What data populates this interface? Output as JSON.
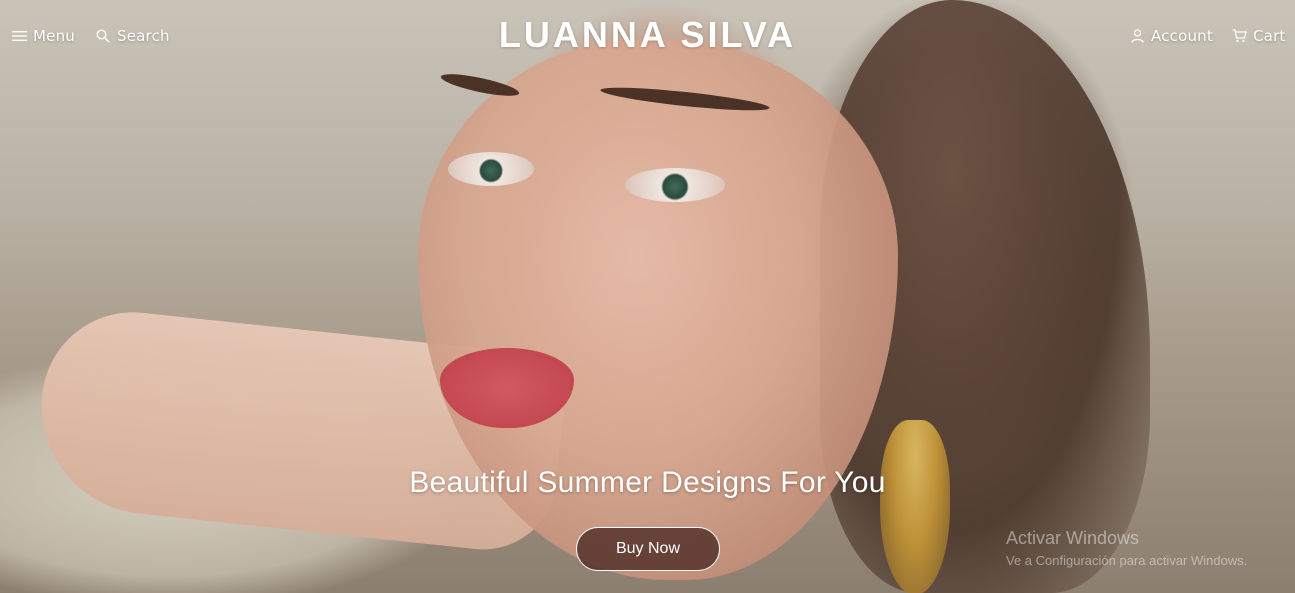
{
  "header": {
    "menu_label": "Menu",
    "search_label": "Search",
    "brand": "LUANNA SILVA",
    "account_label": "Account",
    "cart_label": "Cart"
  },
  "hero": {
    "headline": "Beautiful Summer Designs For You",
    "cta_label": "Buy Now",
    "image": "portrait-of-woman-with-earring"
  },
  "icons": {
    "menu": "hamburger-icon",
    "search": "search-icon",
    "account": "user-icon",
    "cart": "cart-icon"
  },
  "watermark": {
    "title": "Activar Windows",
    "subtitle": "Ve a Configuración para activar Windows."
  },
  "colors": {
    "nav_text": "#ffffff",
    "button_bg": "#55322c",
    "button_border": "#ffffff"
  }
}
